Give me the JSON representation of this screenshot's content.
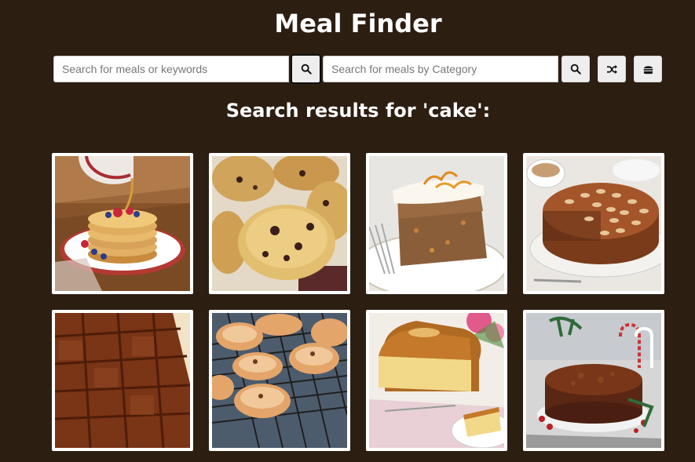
{
  "header": {
    "title": "Meal Finder"
  },
  "search": {
    "keyword_placeholder": "Search for meals or keywords",
    "keyword_value": "",
    "category_placeholder": "Search for meals by Category",
    "category_value": ""
  },
  "icons": {
    "search": "search-icon",
    "random": "shuffle-icon",
    "menu": "burger-icon"
  },
  "results": {
    "heading": "Search results for 'cake':",
    "meals": [
      {
        "image": "pancakes"
      },
      {
        "image": "rock-cakes"
      },
      {
        "image": "carrot-cake"
      },
      {
        "image": "dundee-cake"
      },
      {
        "image": "parkin"
      },
      {
        "image": "eccles-cakes"
      },
      {
        "image": "madeira-cake"
      },
      {
        "image": "christmas-cake"
      }
    ]
  },
  "colors": {
    "background": "#2d1e12",
    "heading_text": "#ffffff",
    "button_bg": "#eeeeee",
    "card_border": "#ffffff"
  }
}
